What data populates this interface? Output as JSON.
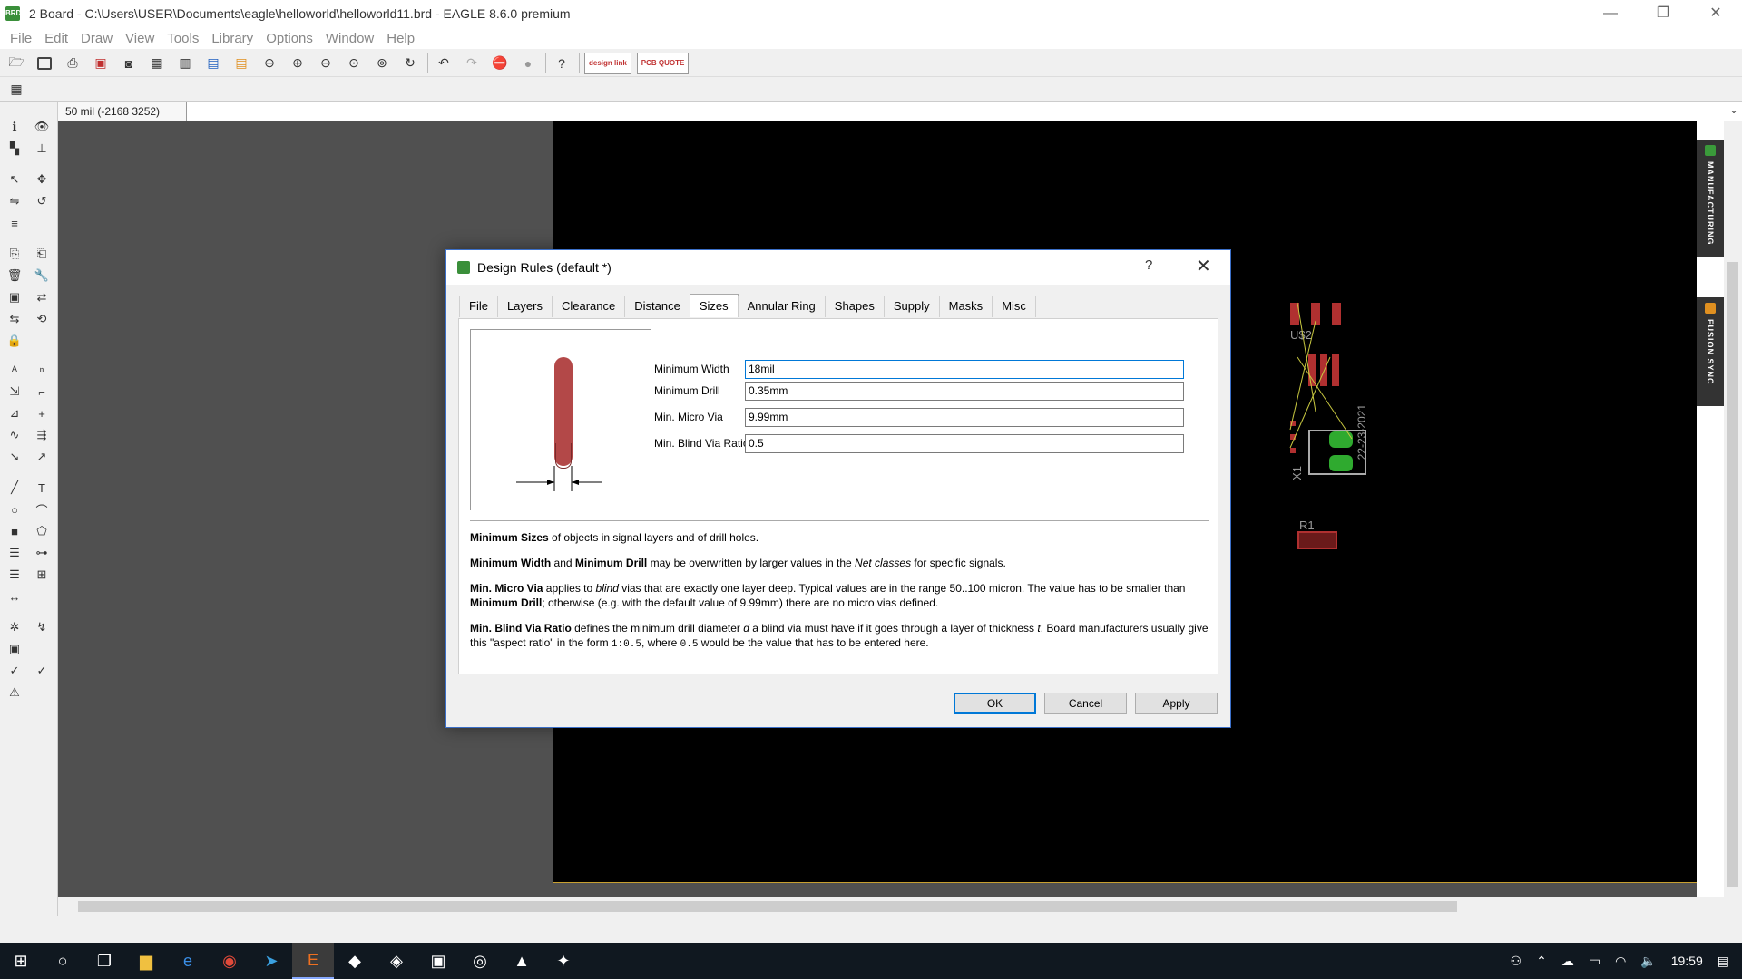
{
  "window": {
    "title": "2 Board - C:\\Users\\USER\\Documents\\eagle\\helloworld\\helloworld11.brd - EAGLE 8.6.0 premium",
    "minimize": "—",
    "restore": "❐",
    "close": "✕"
  },
  "menu": [
    "File",
    "Edit",
    "Draw",
    "View",
    "Tools",
    "Library",
    "Options",
    "Window",
    "Help"
  ],
  "toolbar": {
    "design_link": "design link",
    "pcb_quote": "PCB QUOTE"
  },
  "command_bar": {
    "coordinates": "50 mil (-2168 3252)",
    "command_value": ""
  },
  "side_tabs": {
    "manufacturing": "MANUFACTURING",
    "fusion_sync": "FUSION SYNC"
  },
  "board": {
    "label_us2": "U$2",
    "label_x1": "X1",
    "label_r1": "R1",
    "date_text": "22-23-2021"
  },
  "dialog": {
    "title": "Design Rules (default *)",
    "help": "?",
    "close": "✕",
    "tabs": [
      "File",
      "Layers",
      "Clearance",
      "Distance",
      "Sizes",
      "Annular Ring",
      "Shapes",
      "Supply",
      "Masks",
      "Misc"
    ],
    "selected_tab": "Sizes",
    "fields": {
      "min_width_label": "Minimum Width",
      "min_width_value": "18mil",
      "min_drill_label": "Minimum Drill",
      "min_drill_value": "0.35mm",
      "micro_via_label": "Min. Micro Via",
      "micro_via_value": "9.99mm",
      "blind_ratio_label": "Min. Blind Via Ratio",
      "blind_ratio_value": "0.5"
    },
    "description": {
      "p1_bold": "Minimum Sizes",
      "p1_rest": " of objects in signal layers and of drill holes.",
      "p2_bold1": "Minimum Width",
      "p2_mid1": " and ",
      "p2_bold2": "Minimum Drill",
      "p2_mid2": " may be overwritten by larger values in the ",
      "p2_italic": "Net classes",
      "p2_end": " for specific signals.",
      "p3_bold1": "Min. Micro Via",
      "p3_mid1": " applies to ",
      "p3_italic": "blind",
      "p3_mid2": " vias that are exactly one layer deep. Typical values are in the range 50..100 micron. The value has to be smaller than ",
      "p3_bold2": "Minimum Drill",
      "p3_end": "; otherwise (e.g. with the default value of 9.99mm) there are no micro vias defined.",
      "p4_bold": "Min. Blind Via Ratio",
      "p4_mid1": " defines the minimum drill diameter ",
      "p4_d": "d",
      "p4_mid2": " a blind via must have if it goes through a layer of thickness ",
      "p4_t": "t",
      "p4_mid3": ". Board manufacturers usually give this \"aspect ratio\" in the form ",
      "p4_mono1": "1:0.5",
      "p4_mid4": ", where ",
      "p4_mono2": "0.5",
      "p4_end": " would be the value that has to be entered here."
    },
    "buttons": {
      "ok": "OK",
      "cancel": "Cancel",
      "apply": "Apply"
    }
  },
  "taskbar": {
    "time": "19:59"
  },
  "colors": {
    "accent": "#0078d7",
    "pad_red": "#b03030",
    "board_outline": "#c8a030",
    "trace_preview": "#b34848"
  }
}
